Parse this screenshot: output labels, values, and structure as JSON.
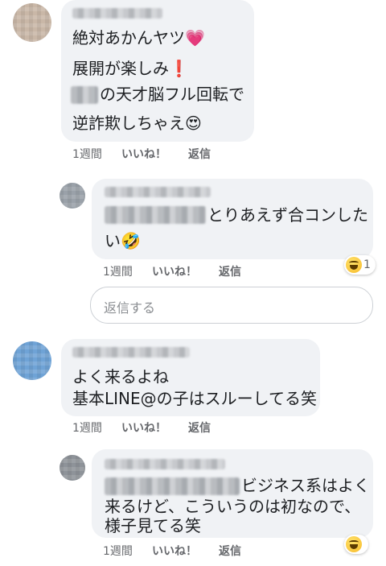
{
  "comments": [
    {
      "lines": [
        "絶対あかんヤツ💗",
        "展開が楽しみ❗",
        "の天才脳フル回転で",
        "逆詐欺しちゃえ😍"
      ],
      "time": "1週間",
      "like": "いいね！",
      "reply": "返信"
    },
    {
      "lines": [
        "とりあえず合コンした",
        "い🤣"
      ],
      "time": "1週間",
      "like": "いいね！",
      "reply": "返信",
      "reaction_count": "1"
    },
    {
      "lines": [
        "よく来るよね",
        "基本LINE@の子はスルーしてる笑"
      ],
      "time": "1週間",
      "like": "いいね！",
      "reply": "返信"
    },
    {
      "lines": [
        "ビジネス系はよく",
        "来るけど、こういうのは初なので、",
        "様子見てる笑"
      ],
      "time": "1週間",
      "like": "いいね！",
      "reply": "返信",
      "reaction_count": ""
    }
  ],
  "reply_input": {
    "placeholder": "返信する"
  },
  "colors": {
    "bubble": "#f0f2f5",
    "meta_text": "#65676b",
    "reaction": "#f7b928"
  }
}
